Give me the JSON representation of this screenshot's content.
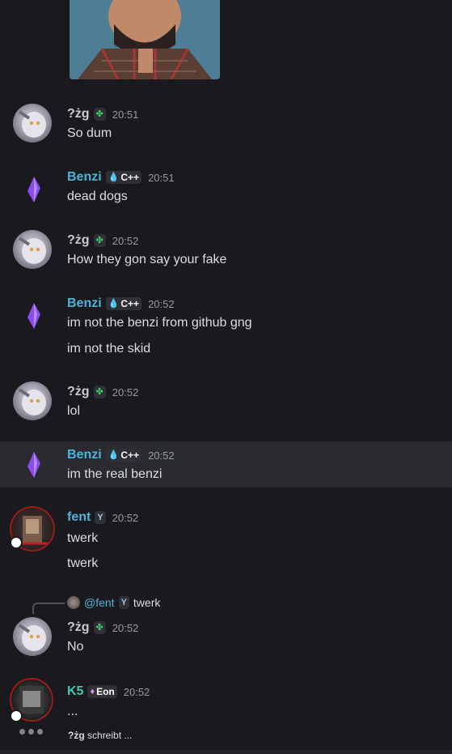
{
  "messages": [
    {
      "user": "?żg",
      "tag_label": "",
      "time": "20:51",
      "lines": [
        "So dum"
      ]
    },
    {
      "user": "Benzi",
      "tag_label": "C++",
      "time": "20:51",
      "lines": [
        "dead dogs"
      ]
    },
    {
      "user": "?żg",
      "tag_label": "",
      "time": "20:52",
      "lines": [
        "How they gon say your fake"
      ]
    },
    {
      "user": "Benzi",
      "tag_label": "C++",
      "time": "20:52",
      "lines": [
        "im not the benzi from github gng",
        "im not the skid"
      ]
    },
    {
      "user": "?żg",
      "tag_label": "",
      "time": "20:52",
      "lines": [
        "lol"
      ]
    },
    {
      "user": "Benzi",
      "tag_label": "C++",
      "time": "20:52",
      "lines": [
        "im the real benzi"
      ]
    },
    {
      "user": "fent",
      "tag_label": "",
      "time": "20:52",
      "lines": [
        "twerk",
        "twerk"
      ]
    },
    {
      "user": "?żg",
      "tag_label": "",
      "time": "20:52",
      "lines": [
        "No"
      ],
      "reply": {
        "user": "@fent",
        "text": "twerk"
      }
    },
    {
      "user": "K5",
      "tag_label": "Eon",
      "time": "20:52",
      "lines": [
        "..."
      ]
    }
  ],
  "typing": {
    "user": "?żg",
    "suffix": "schreibt ..."
  },
  "colors": {
    "background": "#1a1a1e",
    "link_blue": "#4fb3d9",
    "teal": "#46c6ae",
    "hover": "#2a2b30"
  },
  "icons": {
    "clover": "clover-icon",
    "water_drop": "water-drop-icon",
    "gem": "gem-icon",
    "y_badge": "y-badge-icon"
  }
}
